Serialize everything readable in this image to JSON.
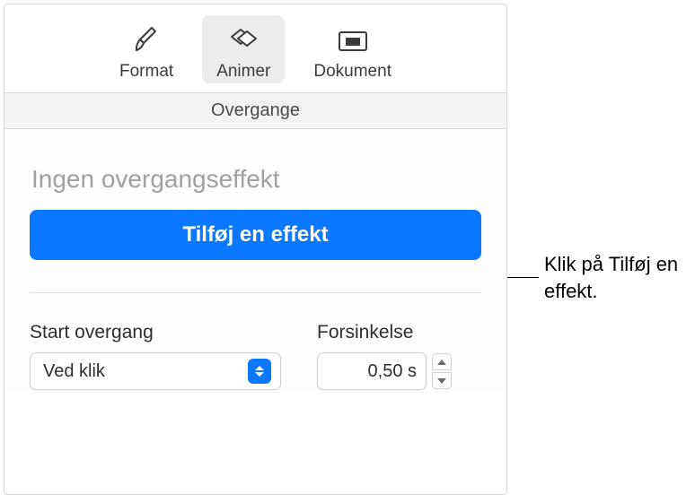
{
  "toolbar": {
    "format": {
      "label": "Format"
    },
    "animate": {
      "label": "Animer"
    },
    "document": {
      "label": "Dokument"
    }
  },
  "subheader": {
    "title": "Overgange"
  },
  "main": {
    "no_effect_text": "Ingen overgangseffekt",
    "add_effect_label": "Tilføj en effekt"
  },
  "start_transition": {
    "label": "Start overgang",
    "value": "Ved klik"
  },
  "delay": {
    "label": "Forsinkelse",
    "value": "0,50 s"
  },
  "callout": {
    "text": "Klik på Tilføj en effekt."
  }
}
